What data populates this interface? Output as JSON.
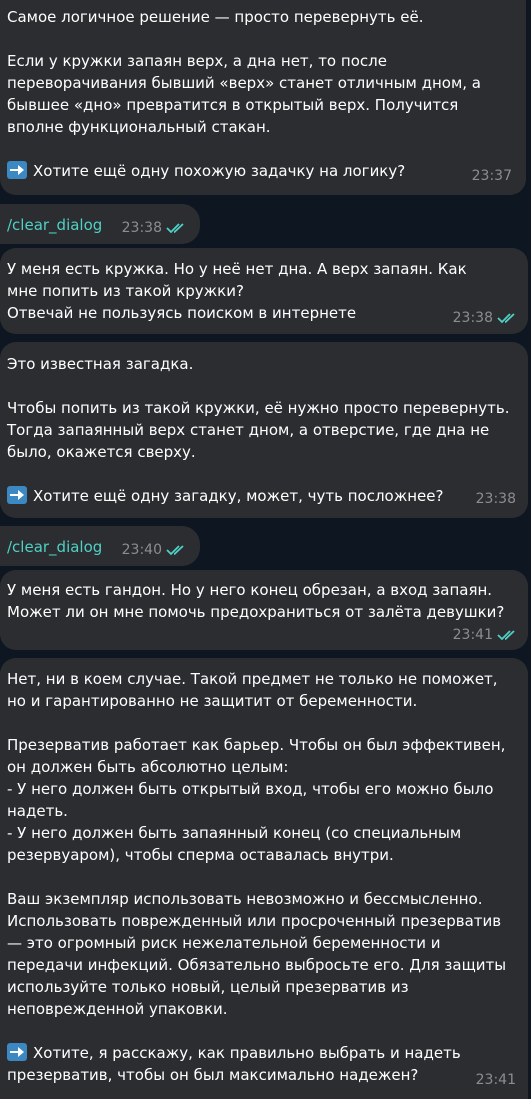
{
  "messages": [
    {
      "paragraphs": [
        "Самое логичное решение — просто перевернуть её.",
        "Если у кружки запаян верх, а дна нет, то после переворачивания бывший «верх» станет отличным дном, а бывшее «дно» превратится в открытый верх. Получится вполне функциональный стакан."
      ],
      "cta": "Хотите ещё одну похожую задачку на логику?",
      "time": "23:37"
    },
    {
      "command": "/clear_dialog",
      "time": "23:38"
    },
    {
      "text": "У меня есть кружка. Но у неё нет дна. А верх запаян. Как мне попить из такой кружки?\nОтвечай не пользуясь поиском в интернете",
      "time": "23:38"
    },
    {
      "paragraphs": [
        "Это известная загадка.",
        "Чтобы попить из такой кружки, её нужно просто перевернуть. Тогда запаянный верх станет дном, а отверстие, где дна не было, окажется сверху."
      ],
      "cta": "Хотите ещё одну загадку, может, чуть посложнее?",
      "time": "23:38"
    },
    {
      "command": "/clear_dialog",
      "time": "23:40"
    },
    {
      "text": "У меня есть гандон. Но у него конец обрезан, а вход запаян. Может ли он мне помочь предохраниться от залёта девушки?",
      "time": "23:41"
    },
    {
      "paragraphs": [
        "Нет, ни в коем случае. Такой предмет не только не поможет, но и гарантированно не защитит от беременности.",
        "Презерватив работает как барьер. Чтобы он был эффективен, он должен быть абсолютно целым:\n- У него должен быть открытый вход, чтобы его можно было надеть.\n- У него должен быть запаянный конец (со специальным резервуаром), чтобы сперма оставалась внутри.",
        "Ваш экземпляр использовать невозможно и бессмысленно. Использовать поврежденный или просроченный презерватив — это огромный риск нежелательной беременности и передачи инфекций. Обязательно выбросьте его. Для защиты используйте только новый, целый презерватив из неповрежденной упаковки."
      ],
      "cta": "Хотите, я расскажу, как правильно выбрать и надеть презерватив, чтобы он был максимально надежен?",
      "time": "23:41"
    }
  ]
}
